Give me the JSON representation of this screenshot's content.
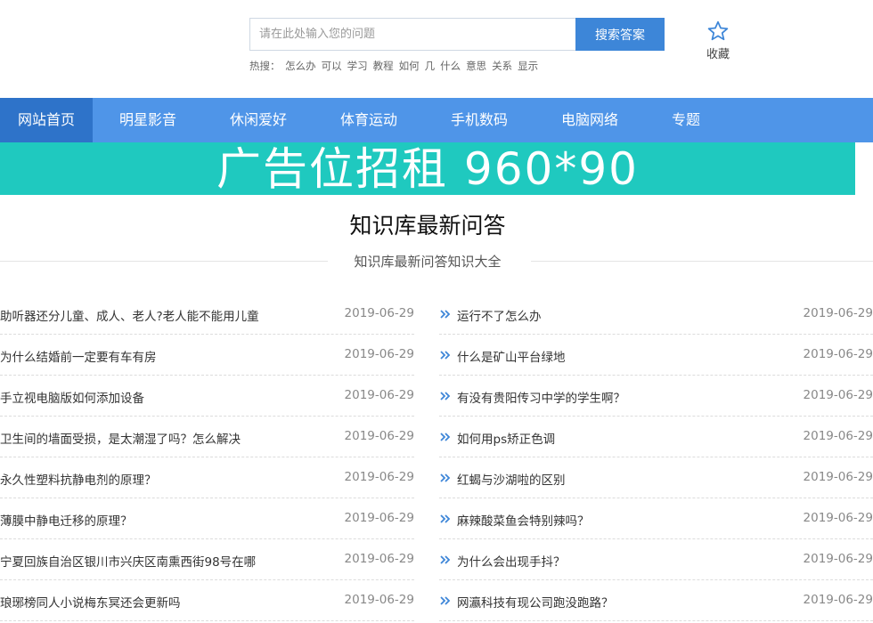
{
  "header": {
    "search_placeholder": "请在此处输入您的问题",
    "search_button": "搜索答案",
    "hot_label": "热搜：",
    "hot_words": [
      "怎么办",
      "可以",
      "学习",
      "教程",
      "如何",
      "几",
      "什么",
      "意思",
      "关系",
      "显示"
    ],
    "favorite_label": "收藏",
    "favorite_icon": "star-icon"
  },
  "nav": {
    "items": [
      "网站首页",
      "明星影音",
      "休闲爱好",
      "体育运动",
      "手机数码",
      "电脑网络",
      "专题"
    ],
    "active_index": 0
  },
  "banner": {
    "text": "广告位招租 960*90"
  },
  "section": {
    "title": "知识库最新问答",
    "subtitle": "知识库最新问答知识大全"
  },
  "left_list": [
    {
      "q": "助听器还分儿童、成人、老人?老人能不能用儿童",
      "date": "2019-06-29"
    },
    {
      "q": "为什么结婚前一定要有车有房",
      "date": "2019-06-29"
    },
    {
      "q": "手立视电脑版如何添加设备",
      "date": "2019-06-29"
    },
    {
      "q": "卫生间的墙面受损，是太潮湿了吗？怎么解决",
      "date": "2019-06-29"
    },
    {
      "q": "永久性塑料抗静电剂的原理？",
      "date": "2019-06-29"
    },
    {
      "q": "薄膜中静电迁移的原理？",
      "date": "2019-06-29"
    },
    {
      "q": "宁夏回族自治区银川市兴庆区南熏西街98号在哪",
      "date": "2019-06-29"
    },
    {
      "q": "琅琊榜同人小说梅东冥还会更新吗",
      "date": "2019-06-29"
    }
  ],
  "right_list": [
    {
      "q": "运行不了怎么办",
      "date": "2019-06-29"
    },
    {
      "q": "什么是矿山平台绿地",
      "date": "2019-06-29"
    },
    {
      "q": "有没有贵阳传习中学的学生啊？",
      "date": "2019-06-29"
    },
    {
      "q": "如何用ps矫正色调",
      "date": "2019-06-29"
    },
    {
      "q": "红蝎与沙湖啦的区别",
      "date": "2019-06-29"
    },
    {
      "q": "麻辣酸菜鱼会特别辣吗？",
      "date": "2019-06-29"
    },
    {
      "q": "为什么会出现手抖？",
      "date": "2019-06-29"
    },
    {
      "q": "网瀛科技有现公司跑没跑路？",
      "date": "2019-06-29"
    }
  ],
  "colors": {
    "nav_bg": "#4f95e8",
    "nav_active": "#2e73c9",
    "search_button": "#3d86d8",
    "banner_bg": "#1fc9bf",
    "chevron": "#3d86d8"
  }
}
